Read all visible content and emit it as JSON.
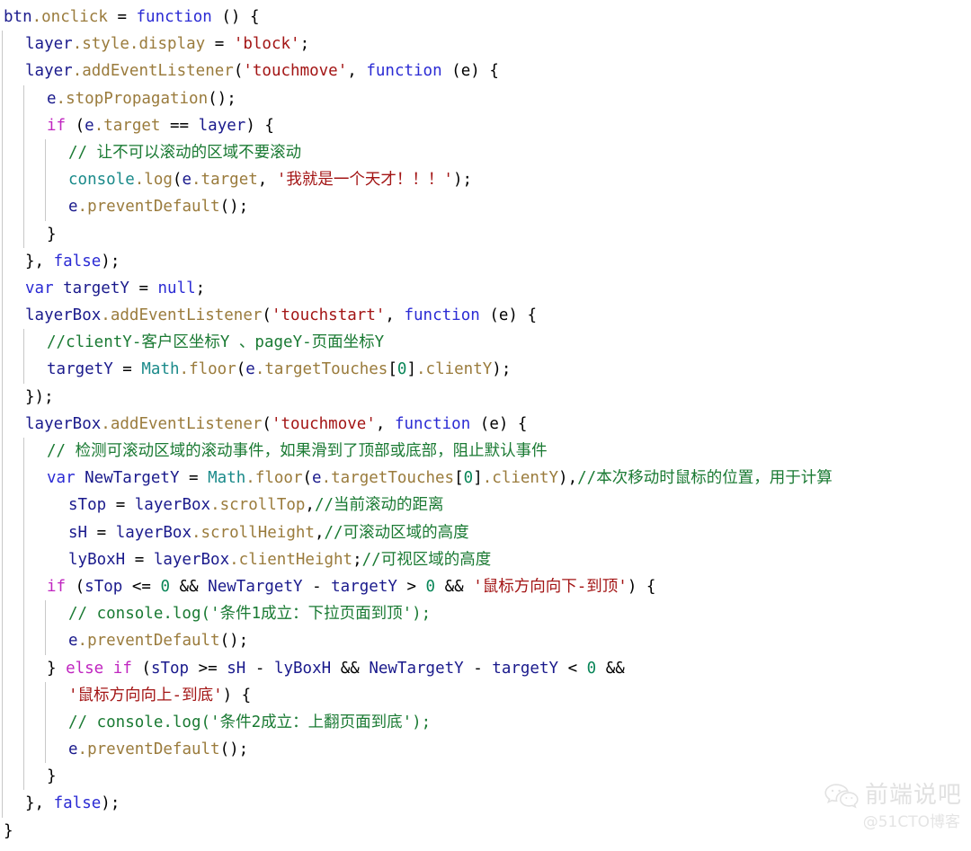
{
  "editor": {
    "language": "javascript",
    "background_color": "#ffffff",
    "guide_color": "#c8c8c8",
    "font_size_px": 17.5,
    "line_height_px": 30.2
  },
  "colors": {
    "plain": "#000000",
    "variable": "#1a1a8c",
    "keyword": "#2b2bd4",
    "conditional": "#c026c0",
    "property": "#9a7b3c",
    "string": "#a31515",
    "comment": "#1a7a33",
    "builtin": "#1a8a8a",
    "number": "#098658"
  },
  "code": {
    "lines": [
      {
        "indent": 0,
        "guides": 0,
        "tokens": [
          {
            "t": "btn",
            "c": "var"
          },
          {
            "t": ".onclick",
            "c": "prop"
          },
          {
            "t": " = ",
            "c": "plain"
          },
          {
            "t": "function",
            "c": "kw"
          },
          {
            "t": " () {",
            "c": "plain"
          }
        ]
      },
      {
        "indent": 1,
        "guides": 1,
        "tokens": [
          {
            "t": "layer",
            "c": "var"
          },
          {
            "t": ".style",
            "c": "prop"
          },
          {
            "t": ".display",
            "c": "prop"
          },
          {
            "t": " = ",
            "c": "plain"
          },
          {
            "t": "'block'",
            "c": "str"
          },
          {
            "t": ";",
            "c": "plain"
          }
        ]
      },
      {
        "indent": 1,
        "guides": 1,
        "tokens": [
          {
            "t": "layer",
            "c": "var"
          },
          {
            "t": ".addEventListener",
            "c": "prop"
          },
          {
            "t": "(",
            "c": "plain"
          },
          {
            "t": "'touchmove'",
            "c": "str"
          },
          {
            "t": ", ",
            "c": "plain"
          },
          {
            "t": "function",
            "c": "kw"
          },
          {
            "t": " (e) {",
            "c": "plain"
          }
        ]
      },
      {
        "indent": 2,
        "guides": 2,
        "tokens": [
          {
            "t": "e",
            "c": "var"
          },
          {
            "t": ".stopPropagation",
            "c": "prop"
          },
          {
            "t": "();",
            "c": "plain"
          }
        ]
      },
      {
        "indent": 2,
        "guides": 2,
        "tokens": [
          {
            "t": "if",
            "c": "cond"
          },
          {
            "t": " (",
            "c": "plain"
          },
          {
            "t": "e",
            "c": "var"
          },
          {
            "t": ".target",
            "c": "prop"
          },
          {
            "t": " == ",
            "c": "plain"
          },
          {
            "t": "layer",
            "c": "var"
          },
          {
            "t": ") {",
            "c": "plain"
          }
        ]
      },
      {
        "indent": 3,
        "guides": 3,
        "tokens": [
          {
            "t": "// 让不可以滚动的区域不要滚动",
            "c": "comment"
          }
        ]
      },
      {
        "indent": 3,
        "guides": 3,
        "tokens": [
          {
            "t": "console",
            "c": "builtin"
          },
          {
            "t": ".log",
            "c": "prop"
          },
          {
            "t": "(",
            "c": "plain"
          },
          {
            "t": "e",
            "c": "var"
          },
          {
            "t": ".target",
            "c": "prop"
          },
          {
            "t": ", ",
            "c": "plain"
          },
          {
            "t": "'我就是一个天才！！！'",
            "c": "str"
          },
          {
            "t": ");",
            "c": "plain"
          }
        ]
      },
      {
        "indent": 3,
        "guides": 3,
        "tokens": [
          {
            "t": "e",
            "c": "var"
          },
          {
            "t": ".preventDefault",
            "c": "prop"
          },
          {
            "t": "();",
            "c": "plain"
          }
        ]
      },
      {
        "indent": 2,
        "guides": 2,
        "tokens": [
          {
            "t": "}",
            "c": "plain"
          }
        ]
      },
      {
        "indent": 1,
        "guides": 1,
        "tokens": [
          {
            "t": "}, ",
            "c": "plain"
          },
          {
            "t": "false",
            "c": "kw"
          },
          {
            "t": ");",
            "c": "plain"
          }
        ]
      },
      {
        "indent": 1,
        "guides": 1,
        "tokens": [
          {
            "t": "var",
            "c": "kw"
          },
          {
            "t": " targetY",
            "c": "var"
          },
          {
            "t": " = ",
            "c": "plain"
          },
          {
            "t": "null",
            "c": "kw"
          },
          {
            "t": ";",
            "c": "plain"
          }
        ]
      },
      {
        "indent": 1,
        "guides": 1,
        "tokens": [
          {
            "t": "layerBox",
            "c": "var"
          },
          {
            "t": ".addEventListener",
            "c": "prop"
          },
          {
            "t": "(",
            "c": "plain"
          },
          {
            "t": "'touchstart'",
            "c": "str"
          },
          {
            "t": ", ",
            "c": "plain"
          },
          {
            "t": "function",
            "c": "kw"
          },
          {
            "t": " (e) {",
            "c": "plain"
          }
        ]
      },
      {
        "indent": 2,
        "guides": 2,
        "tokens": [
          {
            "t": "//clientY-客户区坐标Y 、pageY-页面坐标Y",
            "c": "comment"
          }
        ]
      },
      {
        "indent": 2,
        "guides": 2,
        "tokens": [
          {
            "t": "targetY",
            "c": "var"
          },
          {
            "t": " = ",
            "c": "plain"
          },
          {
            "t": "Math",
            "c": "builtin"
          },
          {
            "t": ".floor",
            "c": "prop"
          },
          {
            "t": "(",
            "c": "plain"
          },
          {
            "t": "e",
            "c": "var"
          },
          {
            "t": ".targetTouches",
            "c": "prop"
          },
          {
            "t": "[",
            "c": "plain"
          },
          {
            "t": "0",
            "c": "num"
          },
          {
            "t": "]",
            "c": "plain"
          },
          {
            "t": ".clientY",
            "c": "prop"
          },
          {
            "t": ");",
            "c": "plain"
          }
        ]
      },
      {
        "indent": 1,
        "guides": 1,
        "tokens": [
          {
            "t": "});",
            "c": "plain"
          }
        ]
      },
      {
        "indent": 1,
        "guides": 1,
        "tokens": [
          {
            "t": "layerBox",
            "c": "var"
          },
          {
            "t": ".addEventListener",
            "c": "prop"
          },
          {
            "t": "(",
            "c": "plain"
          },
          {
            "t": "'touchmove'",
            "c": "str"
          },
          {
            "t": ", ",
            "c": "plain"
          },
          {
            "t": "function",
            "c": "kw"
          },
          {
            "t": " (e) {",
            "c": "plain"
          }
        ]
      },
      {
        "indent": 2,
        "guides": 2,
        "tokens": [
          {
            "t": "// 检测可滚动区域的滚动事件，如果滑到了顶部或底部，阻止默认事件",
            "c": "comment"
          }
        ]
      },
      {
        "indent": 2,
        "guides": 2,
        "tokens": [
          {
            "t": "var",
            "c": "kw"
          },
          {
            "t": " NewTargetY",
            "c": "var"
          },
          {
            "t": " = ",
            "c": "plain"
          },
          {
            "t": "Math",
            "c": "builtin"
          },
          {
            "t": ".floor",
            "c": "prop"
          },
          {
            "t": "(",
            "c": "plain"
          },
          {
            "t": "e",
            "c": "var"
          },
          {
            "t": ".targetTouches",
            "c": "prop"
          },
          {
            "t": "[",
            "c": "plain"
          },
          {
            "t": "0",
            "c": "num"
          },
          {
            "t": "]",
            "c": "plain"
          },
          {
            "t": ".clientY",
            "c": "prop"
          },
          {
            "t": "),",
            "c": "plain"
          },
          {
            "t": "//本次移动时鼠标的位置，用于计算",
            "c": "comment"
          }
        ]
      },
      {
        "indent": 3,
        "guides": 2,
        "tokens": [
          {
            "t": "sTop",
            "c": "var"
          },
          {
            "t": " = ",
            "c": "plain"
          },
          {
            "t": "layerBox",
            "c": "var"
          },
          {
            "t": ".scrollTop",
            "c": "prop"
          },
          {
            "t": ",",
            "c": "plain"
          },
          {
            "t": "//当前滚动的距离",
            "c": "comment"
          }
        ]
      },
      {
        "indent": 3,
        "guides": 2,
        "tokens": [
          {
            "t": "sH",
            "c": "var"
          },
          {
            "t": " = ",
            "c": "plain"
          },
          {
            "t": "layerBox",
            "c": "var"
          },
          {
            "t": ".scrollHeight",
            "c": "prop"
          },
          {
            "t": ",",
            "c": "plain"
          },
          {
            "t": "//可滚动区域的高度",
            "c": "comment"
          }
        ]
      },
      {
        "indent": 3,
        "guides": 2,
        "tokens": [
          {
            "t": "lyBoxH",
            "c": "var"
          },
          {
            "t": " = ",
            "c": "plain"
          },
          {
            "t": "layerBox",
            "c": "var"
          },
          {
            "t": ".clientHeight",
            "c": "prop"
          },
          {
            "t": ";",
            "c": "plain"
          },
          {
            "t": "//可视区域的高度",
            "c": "comment"
          }
        ]
      },
      {
        "indent": 2,
        "guides": 2,
        "tokens": [
          {
            "t": "if",
            "c": "cond"
          },
          {
            "t": " (",
            "c": "plain"
          },
          {
            "t": "sTop",
            "c": "var"
          },
          {
            "t": " <= ",
            "c": "plain"
          },
          {
            "t": "0",
            "c": "num"
          },
          {
            "t": " && ",
            "c": "plain"
          },
          {
            "t": "NewTargetY",
            "c": "var"
          },
          {
            "t": " - ",
            "c": "plain"
          },
          {
            "t": "targetY",
            "c": "var"
          },
          {
            "t": " > ",
            "c": "plain"
          },
          {
            "t": "0",
            "c": "num"
          },
          {
            "t": " && ",
            "c": "plain"
          },
          {
            "t": "'鼠标方向向下-到顶'",
            "c": "str"
          },
          {
            "t": ") {",
            "c": "plain"
          }
        ]
      },
      {
        "indent": 3,
        "guides": 3,
        "tokens": [
          {
            "t": "// console.log('条件1成立：下拉页面到顶');",
            "c": "comment"
          }
        ]
      },
      {
        "indent": 3,
        "guides": 3,
        "tokens": [
          {
            "t": "e",
            "c": "var"
          },
          {
            "t": ".preventDefault",
            "c": "prop"
          },
          {
            "t": "();",
            "c": "plain"
          }
        ]
      },
      {
        "indent": 2,
        "guides": 2,
        "tokens": [
          {
            "t": "} ",
            "c": "plain"
          },
          {
            "t": "else",
            "c": "cond"
          },
          {
            "t": " ",
            "c": "plain"
          },
          {
            "t": "if",
            "c": "cond"
          },
          {
            "t": " (",
            "c": "plain"
          },
          {
            "t": "sTop",
            "c": "var"
          },
          {
            "t": " >= ",
            "c": "plain"
          },
          {
            "t": "sH",
            "c": "var"
          },
          {
            "t": " - ",
            "c": "plain"
          },
          {
            "t": "lyBoxH",
            "c": "var"
          },
          {
            "t": " && ",
            "c": "plain"
          },
          {
            "t": "NewTargetY",
            "c": "var"
          },
          {
            "t": " - ",
            "c": "plain"
          },
          {
            "t": "targetY",
            "c": "var"
          },
          {
            "t": " < ",
            "c": "plain"
          },
          {
            "t": "0",
            "c": "num"
          },
          {
            "t": " &&",
            "c": "plain"
          }
        ]
      },
      {
        "indent": 3,
        "guides": 3,
        "tokens": [
          {
            "t": "'鼠标方向向上-到底'",
            "c": "str"
          },
          {
            "t": ") {",
            "c": "plain"
          }
        ]
      },
      {
        "indent": 3,
        "guides": 3,
        "tokens": [
          {
            "t": "// console.log('条件2成立：上翻页面到底');",
            "c": "comment"
          }
        ]
      },
      {
        "indent": 3,
        "guides": 3,
        "tokens": [
          {
            "t": "e",
            "c": "var"
          },
          {
            "t": ".preventDefault",
            "c": "prop"
          },
          {
            "t": "();",
            "c": "plain"
          }
        ]
      },
      {
        "indent": 2,
        "guides": 2,
        "tokens": [
          {
            "t": "}",
            "c": "plain"
          }
        ]
      },
      {
        "indent": 1,
        "guides": 1,
        "tokens": [
          {
            "t": "}, ",
            "c": "plain"
          },
          {
            "t": "false",
            "c": "kw"
          },
          {
            "t": ");",
            "c": "plain"
          }
        ]
      },
      {
        "indent": 0,
        "guides": 0,
        "tokens": [
          {
            "t": "}",
            "c": "plain"
          }
        ]
      }
    ]
  },
  "watermark": {
    "icon": "wechat-icon",
    "brand": "前端说吧",
    "handle": "@51CTO博客"
  }
}
